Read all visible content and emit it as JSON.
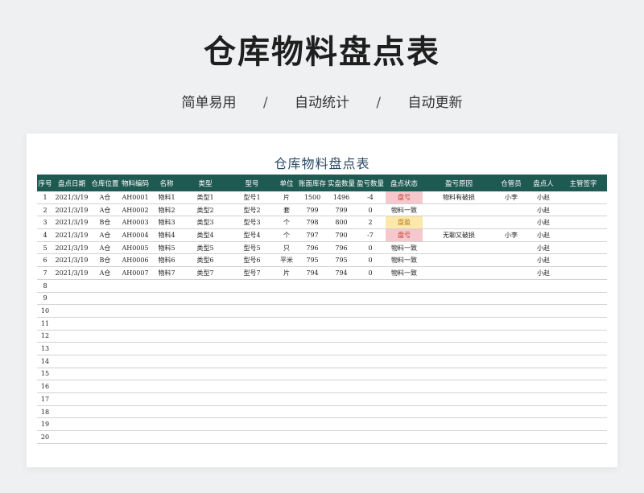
{
  "hero": {
    "title": "仓库物料盘点表",
    "subtitle_items": [
      "简单易用",
      "自动统计",
      "自动更新"
    ],
    "separator": "/"
  },
  "sheet": {
    "title": "仓库物料盘点表",
    "headers": [
      "序号",
      "盘点日期",
      "仓库位置",
      "物料编码",
      "名称",
      "类型",
      "型号",
      "单位",
      "账面库存",
      "实盘数量",
      "盈亏数量",
      "盘点状态",
      "盈亏原因",
      "仓管员",
      "盘点人",
      "主管签字"
    ],
    "rows": [
      [
        "1",
        "2021/3/19",
        "A仓",
        "AH0001",
        "物料1",
        "类型1",
        "型号1",
        "片",
        "1500",
        "1496",
        "-4",
        "盘亏",
        "物料有破损",
        "小李",
        "小赵",
        ""
      ],
      [
        "2",
        "2021/3/19",
        "A仓",
        "AH0002",
        "物料2",
        "类型2",
        "型号2",
        "套",
        "799",
        "799",
        "0",
        "物料一致",
        "",
        "",
        "小赵",
        ""
      ],
      [
        "3",
        "2021/3/19",
        "B仓",
        "AH0003",
        "物料3",
        "类型3",
        "型号3",
        "个",
        "798",
        "800",
        "2",
        "盘盈",
        "",
        "",
        "小赵",
        ""
      ],
      [
        "4",
        "2021/3/19",
        "A仓",
        "AH0004",
        "物料4",
        "类型4",
        "型号4",
        "个",
        "797",
        "790",
        "-7",
        "盘亏",
        "无聊又破损",
        "小李",
        "小赵",
        ""
      ],
      [
        "5",
        "2021/3/19",
        "A仓",
        "AH0005",
        "物料5",
        "类型5",
        "型号5",
        "只",
        "796",
        "796",
        "0",
        "物料一致",
        "",
        "",
        "小赵",
        ""
      ],
      [
        "6",
        "2021/3/19",
        "B仓",
        "AH0006",
        "物料6",
        "类型6",
        "型号6",
        "平米",
        "795",
        "795",
        "0",
        "物料一致",
        "",
        "",
        "小赵",
        ""
      ],
      [
        "7",
        "2021/3/19",
        "A仓",
        "AH0007",
        "物料7",
        "类型7",
        "型号7",
        "片",
        "794",
        "794",
        "0",
        "物料一致",
        "",
        "",
        "小赵",
        ""
      ],
      [
        "8",
        "",
        "",
        "",
        "",
        "",
        "",
        "",
        "",
        "",
        "",
        "",
        "",
        "",
        "",
        ""
      ],
      [
        "9",
        "",
        "",
        "",
        "",
        "",
        "",
        "",
        "",
        "",
        "",
        "",
        "",
        "",
        "",
        ""
      ],
      [
        "10",
        "",
        "",
        "",
        "",
        "",
        "",
        "",
        "",
        "",
        "",
        "",
        "",
        "",
        "",
        ""
      ],
      [
        "11",
        "",
        "",
        "",
        "",
        "",
        "",
        "",
        "",
        "",
        "",
        "",
        "",
        "",
        "",
        ""
      ],
      [
        "12",
        "",
        "",
        "",
        "",
        "",
        "",
        "",
        "",
        "",
        "",
        "",
        "",
        "",
        "",
        ""
      ],
      [
        "13",
        "",
        "",
        "",
        "",
        "",
        "",
        "",
        "",
        "",
        "",
        "",
        "",
        "",
        "",
        ""
      ],
      [
        "14",
        "",
        "",
        "",
        "",
        "",
        "",
        "",
        "",
        "",
        "",
        "",
        "",
        "",
        "",
        ""
      ],
      [
        "15",
        "",
        "",
        "",
        "",
        "",
        "",
        "",
        "",
        "",
        "",
        "",
        "",
        "",
        "",
        ""
      ],
      [
        "16",
        "",
        "",
        "",
        "",
        "",
        "",
        "",
        "",
        "",
        "",
        "",
        "",
        "",
        "",
        ""
      ],
      [
        "17",
        "",
        "",
        "",
        "",
        "",
        "",
        "",
        "",
        "",
        "",
        "",
        "",
        "",
        "",
        ""
      ],
      [
        "18",
        "",
        "",
        "",
        "",
        "",
        "",
        "",
        "",
        "",
        "",
        "",
        "",
        "",
        "",
        ""
      ],
      [
        "19",
        "",
        "",
        "",
        "",
        "",
        "",
        "",
        "",
        "",
        "",
        "",
        "",
        "",
        "",
        ""
      ],
      [
        "20",
        "",
        "",
        "",
        "",
        "",
        "",
        "",
        "",
        "",
        "",
        "",
        "",
        "",
        "",
        ""
      ]
    ]
  },
  "colors": {
    "header_bg": "#1f5a52",
    "loss_bg": "#f6c7cc",
    "gain_bg": "#fce8a8",
    "title_color": "#2c4a66"
  }
}
